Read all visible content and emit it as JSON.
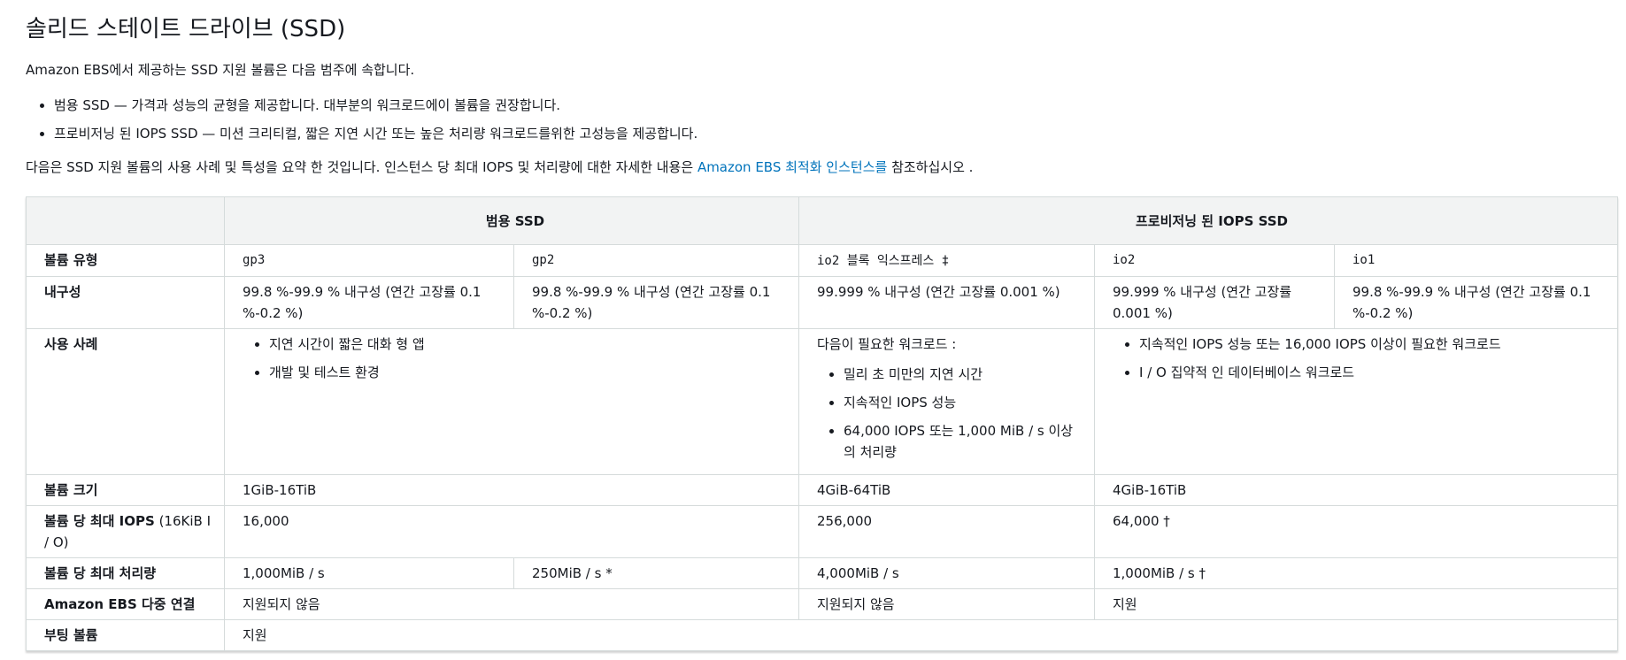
{
  "title": "솔리드 스테이트 드라이브 (SSD)",
  "intro": "Amazon EBS에서 제공하는 SSD 지원 볼륨은 다음 범주에 속합니다.",
  "bullets": [
    "범용 SSD — 가격과 성능의 균형을 제공합니다. 대부분의 워크로드에이 볼륨을 권장합니다.",
    "프로비저닝 된 IOPS SSD — 미션 크리티컬, 짧은 지연 시간 또는 높은 처리량 워크로드를위한 고성능을 제공합니다."
  ],
  "summary": {
    "before": "다음은 SSD 지원 볼륨의 사용 사례 및 특성을 요약 한 것입니다. 인스턴스 당 최대 IOPS 및 처리량에 대한 자세한 내용은 ",
    "link": "Amazon EBS 최적화 인스턴스를",
    "after": " 참조하십시오 ."
  },
  "table": {
    "groups": [
      "범용 SSD",
      "프로비저닝 된 IOPS SSD"
    ],
    "rows": {
      "volume_type": {
        "label": "볼륨 유형",
        "gp3": "gp3",
        "gp2": "gp2",
        "io2x": "io2 블록 익스프레스 ‡",
        "io2": "io2",
        "io1": "io1"
      },
      "durability": {
        "label": "내구성",
        "gp3": "99.8 %-99.9 % 내구성 (연간 고장률 0.1 %-0.2 %)",
        "gp2": "99.8 %-99.9 % 내구성 (연간 고장률 0.1 %-0.2 %)",
        "io2x": "99.999 % 내구성 (연간 고장률 0.001 %)",
        "io2": "99.999 % 내구성 (연간 고장률 0.001 %)",
        "io1": "99.8 %-99.9 % 내구성 (연간 고장률 0.1 %-0.2 %)"
      },
      "use_cases": {
        "label": "사용 사례",
        "general": [
          "지연 시간이 짧은 대화 형 앱",
          "개발 및 테스트 환경"
        ],
        "io2x_lead": "다음이 필요한 워크로드 :",
        "io2x": [
          "밀리 초 미만의 지연 시간",
          "지속적인 IOPS 성능",
          "64,000 IOPS 또는 1,000 MiB / s 이상의 처리량"
        ],
        "io": [
          "지속적인 IOPS 성능 또는 16,000 IOPS 이상이 필요한 워크로드",
          "I / O 집약적 인 데이터베이스 워크로드"
        ]
      },
      "size": {
        "label": "볼륨 크기",
        "general": "1GiB-16TiB",
        "io2x": "4GiB-64TiB",
        "io": "4GiB-16TiB"
      },
      "iops": {
        "label_bold": "볼륨 당 최대 IOPS",
        "label_rest": " (16KiB I / O)",
        "general": "16,000",
        "io2x": "256,000",
        "io": "64,000 †"
      },
      "throughput": {
        "label": "볼륨 당 최대 처리량",
        "gp3": "1,000MiB / s",
        "gp2": "250MiB / s *",
        "io2x": "4,000MiB / s",
        "io": "1,000MiB / s †"
      },
      "multi_attach": {
        "label": "Amazon EBS 다중 연결",
        "general": "지원되지 않음",
        "io2x": "지원되지 않음",
        "io": "지원"
      },
      "boot": {
        "label": "부팅 볼륨",
        "value": "지원"
      }
    }
  }
}
